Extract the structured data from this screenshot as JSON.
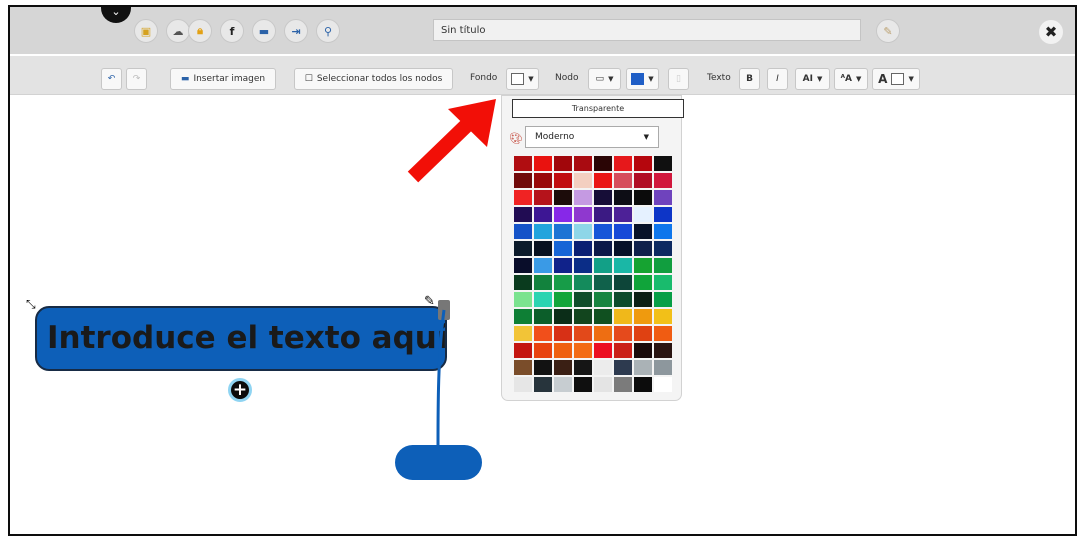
{
  "title_input": {
    "value": "Sin título"
  },
  "topbar": {
    "collapse_icon": "chevron-down-icon",
    "close_icon": "x-icon"
  },
  "toolbar": {
    "insert_image": "Insertar imagen",
    "select_all": "Seleccionar todos los nodos",
    "fondo_label": "Fondo",
    "nodo_label": "Nodo",
    "texto_label": "Texto",
    "bold": "B",
    "italic": "I",
    "font_size": "AI",
    "font_face": "ᴬA",
    "text_color": "A"
  },
  "colors": {
    "node_fill": "#0d5fb8",
    "node_border": "#172b45",
    "arrow": "#f20f07"
  },
  "dropdown": {
    "transparent": "Transparente",
    "palette_name": "Moderno",
    "palette_colors": [
      "#b00d11",
      "#e9120f",
      "#a1060b",
      "#a90b11",
      "#2a0505",
      "#e6181b",
      "#b5060d",
      "#101010",
      "#710a0a",
      "#990809",
      "#c10d10",
      "#f3cfc0",
      "#ea1515",
      "#d64d5c",
      "#b10d24",
      "#d1173c",
      "#f02323",
      "#b5131b",
      "#1c0c0a",
      "#c59ae2",
      "#160d37",
      "#0d0d15",
      "#0b0b0b",
      "#6f43bd",
      "#210c53",
      "#3d1694",
      "#8728e8",
      "#8f38cf",
      "#3b1a83",
      "#4d2197",
      "#e5f1ff",
      "#0d35c7",
      "#1553c8",
      "#22a4dd",
      "#1d74d4",
      "#8ed6e8",
      "#1655d8",
      "#1749d7",
      "#081228",
      "#0e76ec",
      "#0c1b2b",
      "#07101f",
      "#1665d6",
      "#0a1f73",
      "#0b1848",
      "#061028",
      "#10214b",
      "#0d2a61",
      "#090d2a",
      "#3a9ae6",
      "#10228a",
      "#0b2d87",
      "#12a087",
      "#1ab7a6",
      "#16a331",
      "#119e3f",
      "#0a3b1e",
      "#12823d",
      "#179c48",
      "#148b5c",
      "#10614b",
      "#0d4539",
      "#10a43a",
      "#19bb6d",
      "#7be38f",
      "#2bd4b1",
      "#13a53a",
      "#0f4c2a",
      "#178440",
      "#0d4a2b",
      "#0b1f14",
      "#079f47",
      "#0e7f35",
      "#0c5e2a",
      "#0b2d18",
      "#12451e",
      "#105020",
      "#f0b81a",
      "#ef9a0e",
      "#f2c018",
      "#f2c437",
      "#f14f1b",
      "#d73016",
      "#e2491a",
      "#ee6e12",
      "#e54a1c",
      "#df4112",
      "#f05c12",
      "#c41510",
      "#e8420f",
      "#ef6010",
      "#f36b15",
      "#ec0e21",
      "#ca2018",
      "#1a0a0a",
      "#2a1512",
      "#7a4d2a",
      "#121212",
      "#3a1f14",
      "#151515",
      "#ececec",
      "#2d3a4f",
      "#aab2b6",
      "#8d979d",
      "#e6e6e6",
      "#27343c",
      "#c7cdd1",
      "#0f0f0f",
      "#e4e4e4",
      "#7b7b7b",
      "#0c0c0c",
      "#ffffff"
    ]
  },
  "central_node": {
    "text": "Introduce el texto aquí"
  }
}
